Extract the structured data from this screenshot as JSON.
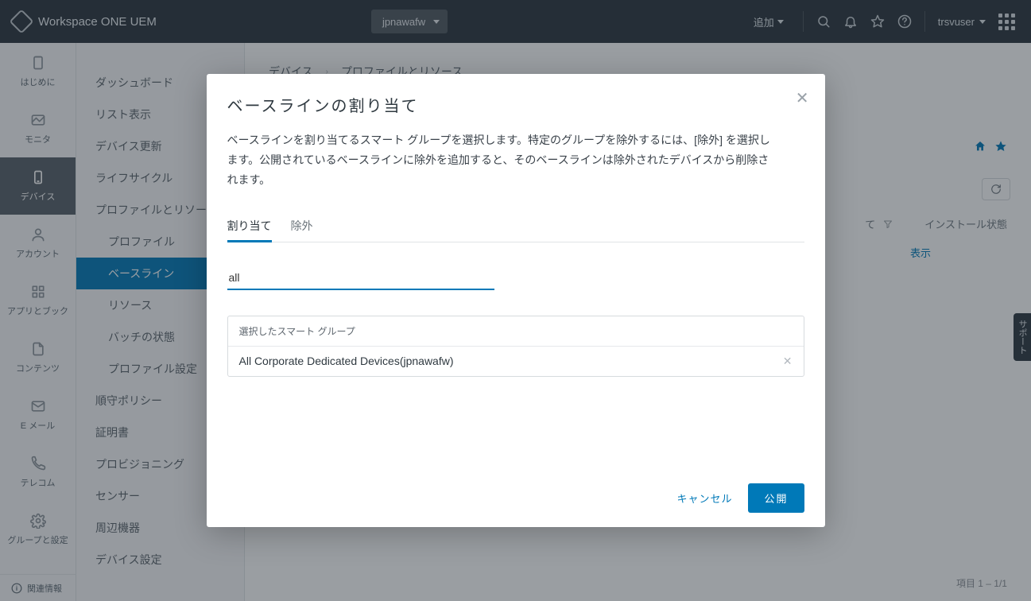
{
  "topbar": {
    "product_title": "Workspace ONE UEM",
    "org_name": "jpnawafw",
    "add_label": "追加",
    "user_name": "trsvuser"
  },
  "rail": {
    "items": [
      {
        "label": "はじめに",
        "id": "getting-started"
      },
      {
        "label": "モニタ",
        "id": "monitor"
      },
      {
        "label": "デバイス",
        "id": "devices"
      },
      {
        "label": "アカウント",
        "id": "accounts"
      },
      {
        "label": "アプリとブック",
        "id": "apps-books"
      },
      {
        "label": "コンテンツ",
        "id": "content"
      },
      {
        "label": "E メール",
        "id": "email"
      },
      {
        "label": "テレコム",
        "id": "telecom"
      },
      {
        "label": "グループと設定",
        "id": "groups-settings"
      }
    ],
    "footer_label": "関連情報"
  },
  "subnav": {
    "items": [
      {
        "label": "ダッシュボード",
        "indent": false
      },
      {
        "label": "リスト表示",
        "indent": false
      },
      {
        "label": "デバイス更新",
        "indent": false
      },
      {
        "label": "ライフサイクル",
        "indent": false
      },
      {
        "label": "プロファイルとリソース",
        "indent": false
      },
      {
        "label": "プロファイル",
        "indent": true
      },
      {
        "label": "ベースライン",
        "indent": true,
        "active": true
      },
      {
        "label": "リソース",
        "indent": true
      },
      {
        "label": "バッチの状態",
        "indent": true
      },
      {
        "label": "プロファイル設定",
        "indent": true
      },
      {
        "label": "順守ポリシー",
        "indent": false
      },
      {
        "label": "証明書",
        "indent": false
      },
      {
        "label": "プロビジョニング",
        "indent": false
      },
      {
        "label": "センサー",
        "indent": false
      },
      {
        "label": "周辺機器",
        "indent": false
      },
      {
        "label": "デバイス設定",
        "indent": false
      }
    ]
  },
  "content": {
    "breadcrumb_root": "デバイス",
    "breadcrumb_current": "プロファイルとリソース",
    "table": {
      "col_assign": "て",
      "col_install": "インストール状態",
      "row_display": "表示",
      "footer": "項目 1 – 1/1"
    }
  },
  "support_tab": "サポート",
  "modal": {
    "title": "ベースラインの割り当て",
    "desc": "ベースラインを割り当てるスマート グループを選択します。特定のグループを除外するには、[除外] を選択します。公開されているベースラインに除外を追加すると、そのベースラインは除外されたデバイスから削除されます。",
    "tabs": {
      "assign": "割り当て",
      "exclude": "除外"
    },
    "search_value": "all",
    "sg_header": "選択したスマート グループ",
    "sg_item": "All Corporate Dedicated Devices(jpnawafw)",
    "cancel": "キャンセル",
    "publish": "公開"
  }
}
